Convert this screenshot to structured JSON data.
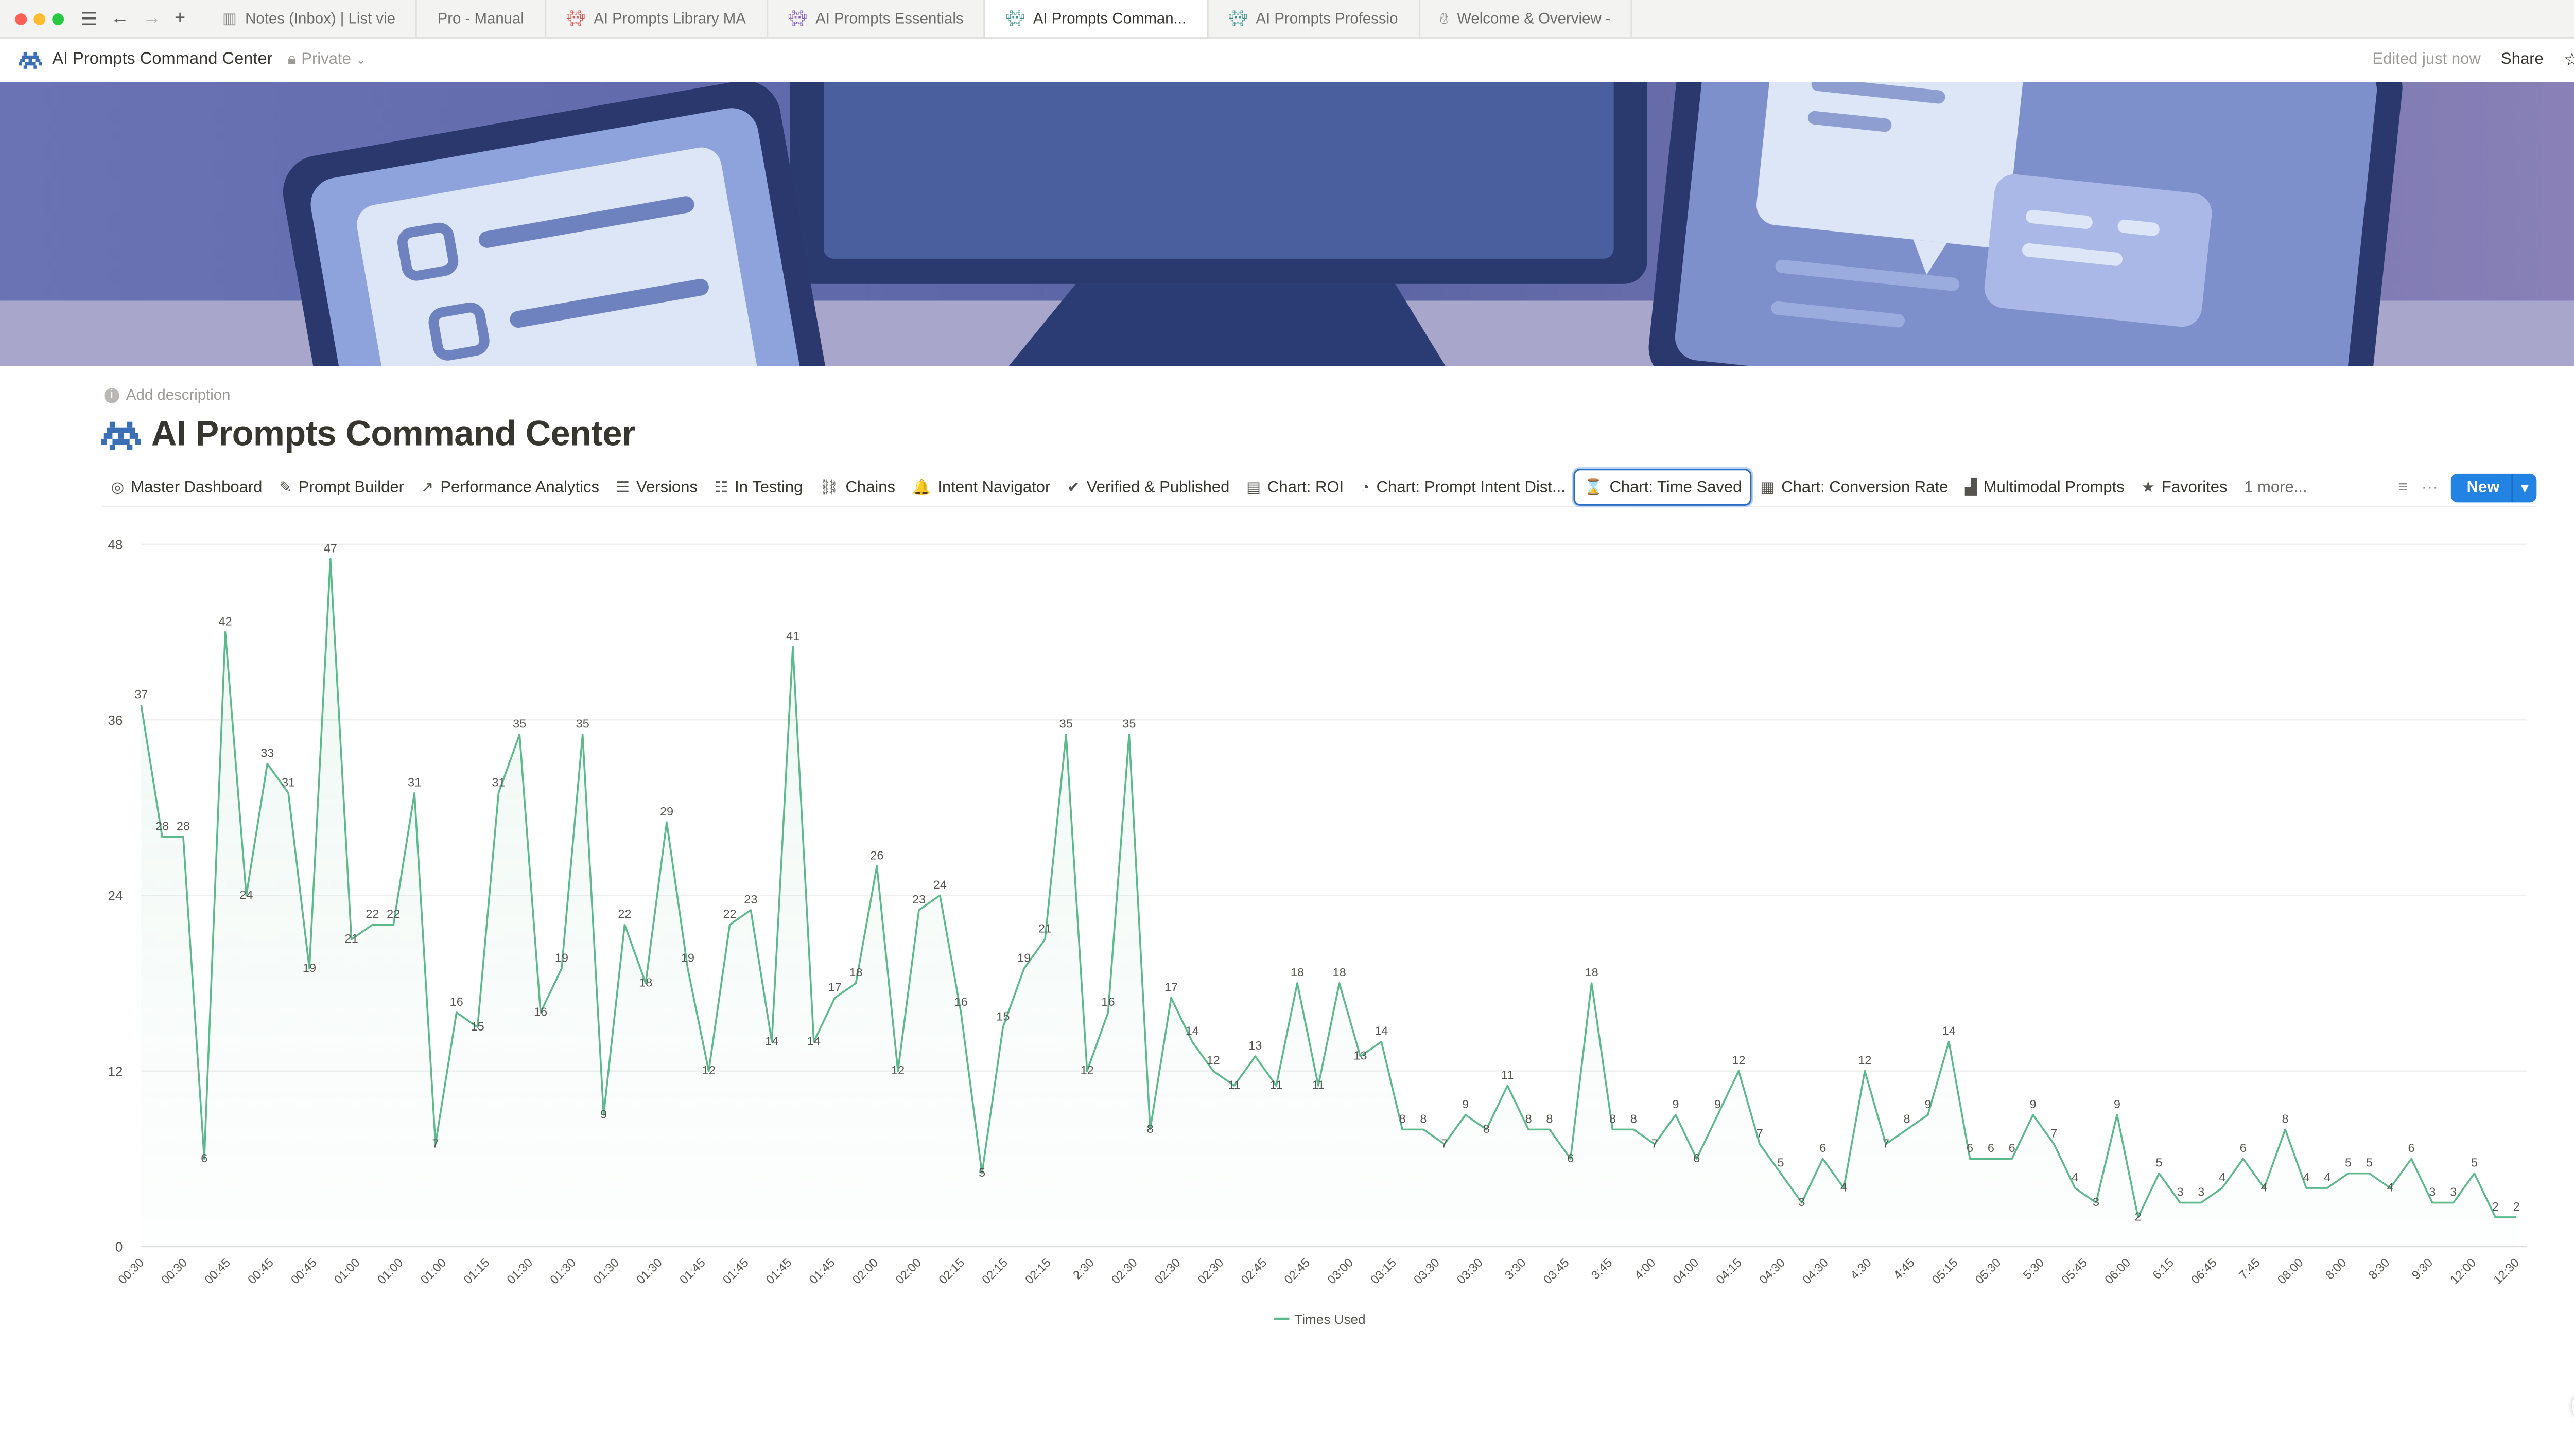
{
  "browser": {
    "tabs": [
      {
        "label": "Notes (Inbox) | List vie",
        "icon": "notebook-icon"
      },
      {
        "label": "Pro - Manual",
        "icon": ""
      },
      {
        "label": "AI Prompts Library MA",
        "icon": "invader-icon"
      },
      {
        "label": "AI Prompts Essentials",
        "icon": "invader-icon"
      },
      {
        "label": "AI Prompts Comman...",
        "icon": "invader-icon"
      },
      {
        "label": "AI Prompts Professio",
        "icon": "invader-icon"
      },
      {
        "label": "Welcome & Overview -",
        "icon": "hand-icon"
      }
    ]
  },
  "page": {
    "breadcrumb": "AI Prompts Command Center",
    "privacy": "Private",
    "edited": "Edited just now",
    "share": "Share",
    "add_description": "Add description",
    "title": "AI Prompts Command Center"
  },
  "views": [
    {
      "label": "Master Dashboard",
      "icon": "◎"
    },
    {
      "label": "Prompt Builder",
      "icon": "✎"
    },
    {
      "label": "Performance Analytics",
      "icon": "↗"
    },
    {
      "label": "Versions",
      "icon": "☰"
    },
    {
      "label": "In Testing",
      "icon": "☷"
    },
    {
      "label": "Chains",
      "icon": "⛓"
    },
    {
      "label": "Intent Navigator",
      "icon": "🔔"
    },
    {
      "label": "Verified & Published",
      "icon": "✔"
    },
    {
      "label": "Chart: ROI",
      "icon": "▤"
    },
    {
      "label": "Chart: Prompt Intent Dist...",
      "icon": "◔"
    },
    {
      "label": "Chart: Time Saved",
      "icon": "⌛"
    },
    {
      "label": "Chart: Conversion Rate",
      "icon": "▦"
    },
    {
      "label": "Multimodal Prompts",
      "icon": "▟"
    },
    {
      "label": "Favorites",
      "icon": "★"
    }
  ],
  "more_views": "1 more...",
  "new_button": "New",
  "colors": {
    "accent": "#2383e2",
    "line": "#5bb98c",
    "active_view_border": "#2d6ec5"
  },
  "chart_data": {
    "type": "line",
    "ylim": [
      0,
      48
    ],
    "yticks": [
      0,
      12,
      24,
      36,
      48
    ],
    "legend": "bottom-center",
    "grid": true,
    "series": [
      {
        "name": "Times Used",
        "values": [
          37,
          28,
          28,
          6,
          42,
          24,
          33,
          31,
          19,
          47,
          21,
          22,
          22,
          31,
          7,
          16,
          15,
          31,
          35,
          16,
          19,
          35,
          9,
          22,
          18,
          29,
          19,
          12,
          22,
          23,
          14,
          41,
          14,
          17,
          18,
          26,
          12,
          23,
          24,
          16,
          5,
          15,
          19,
          21,
          35,
          12,
          16,
          35,
          8,
          17,
          14,
          12,
          11,
          13,
          11,
          18,
          11,
          18,
          13,
          14,
          8,
          8,
          7,
          9,
          8,
          11,
          8,
          8,
          6,
          18,
          8,
          8,
          7,
          9,
          6,
          9,
          12,
          7,
          5,
          3,
          6,
          4,
          12,
          7,
          8,
          9,
          14,
          6,
          6,
          6,
          9,
          7,
          4,
          3,
          9,
          2,
          5,
          3,
          3,
          4,
          6,
          4,
          8,
          4,
          4,
          5,
          5,
          4,
          6,
          3,
          3,
          5,
          2,
          2
        ]
      }
    ],
    "xlabels": [
      "00:30",
      "00:30",
      "00:45",
      "00:45",
      "00:45",
      "01:00",
      "01:00",
      "01:00",
      "01:15",
      "01:30",
      "01:30",
      "01:30",
      "01:30",
      "01:45",
      "01:45",
      "01:45",
      "01:45",
      "02:00",
      "02:00",
      "02:15",
      "02:15",
      "02:15",
      "2:30",
      "02:30",
      "02:30",
      "02:30",
      "02:45",
      "02:45",
      "03:00",
      "03:15",
      "03:30",
      "03:30",
      "3:30",
      "03:45",
      "3:45",
      "4:00",
      "04:00",
      "04:15",
      "04:30",
      "04:30",
      "4:30",
      "4:45",
      "05:15",
      "05:30",
      "5:30",
      "05:45",
      "06:00",
      "6:15",
      "06:45",
      "7:45",
      "08:00",
      "8:00",
      "8:30",
      "9:30",
      "12:00",
      "12:30"
    ]
  }
}
